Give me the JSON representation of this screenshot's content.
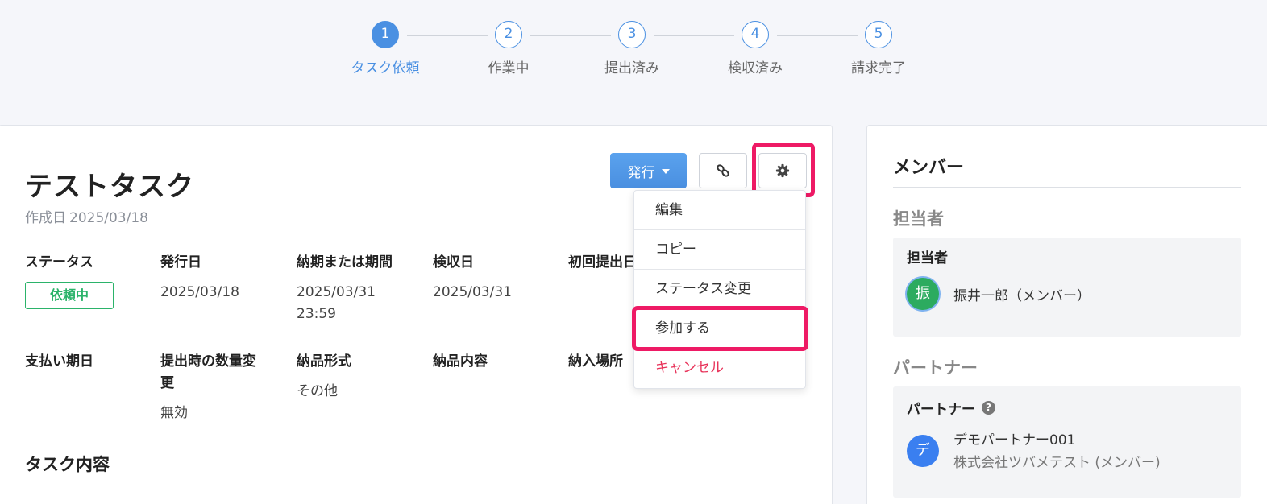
{
  "stepper": {
    "steps": [
      {
        "number": "1",
        "label": "タスク依頼",
        "active": true
      },
      {
        "number": "2",
        "label": "作業中"
      },
      {
        "number": "3",
        "label": "提出済み"
      },
      {
        "number": "4",
        "label": "検収済み"
      },
      {
        "number": "5",
        "label": "請求完了"
      }
    ]
  },
  "task": {
    "title": "テストタスク",
    "created_label": "作成日",
    "created_date": "2025/03/18",
    "toolbar": {
      "issue_label": "発行",
      "link_icon": "link-icon",
      "gear_icon": "gear-icon"
    },
    "fields_row1": [
      {
        "label": "ステータス",
        "badge": "依頼中"
      },
      {
        "label": "発行日",
        "value": "2025/03/18"
      },
      {
        "label": "納期または期間",
        "value": "2025/03/31",
        "value2": "23:59"
      },
      {
        "label": "検収日",
        "value": "2025/03/31"
      },
      {
        "label": "初回提出日"
      }
    ],
    "fields_row2": [
      {
        "label": "支払い期日"
      },
      {
        "label": "提出時の数量変",
        "label2": "更",
        "value": "無効"
      },
      {
        "label": "納品形式",
        "value": "その他"
      },
      {
        "label": "納品内容"
      },
      {
        "label": "納入場所"
      }
    ],
    "section_title": "タスク内容"
  },
  "dropdown": {
    "items": [
      {
        "label": "編集"
      },
      {
        "label": "コピー"
      },
      {
        "label": "ステータス変更"
      },
      {
        "label": "参加する"
      },
      {
        "label": "キャンセル",
        "danger": true
      }
    ]
  },
  "members": {
    "title": "メンバー",
    "assignee_section": "担当者",
    "assignee_box_label": "担当者",
    "assignee": {
      "avatar": "振",
      "name": "振井一郎（メンバー）"
    },
    "partner_section": "パートナー",
    "partner_box_label": "パートナー",
    "partner": {
      "avatar": "デ",
      "name": "デモパートナー001",
      "org": "株式会社ツバメテスト (メンバー)"
    }
  },
  "colors": {
    "accent": "#4a90e2",
    "status_green": "#2bb36a",
    "highlight": "#ee1a65",
    "danger": "#e8335a"
  }
}
